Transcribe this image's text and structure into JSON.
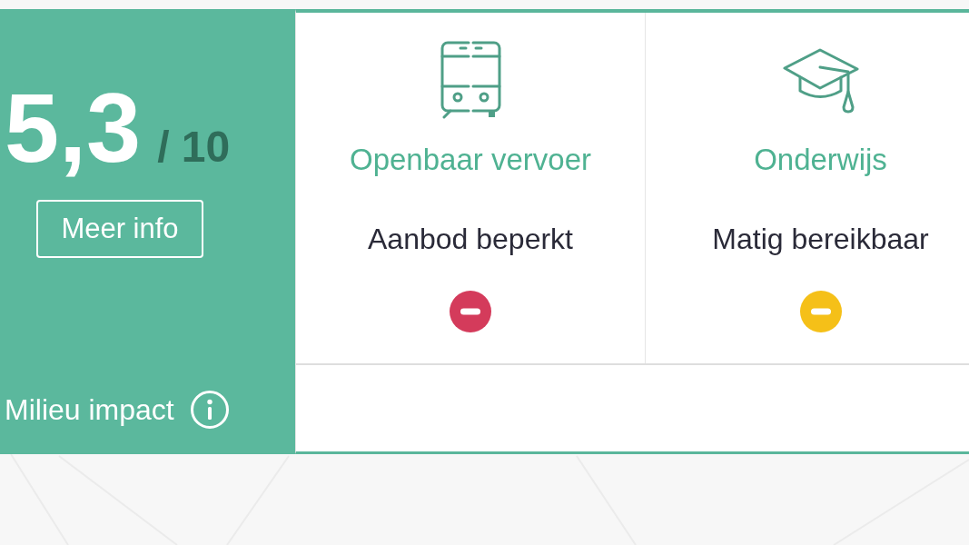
{
  "score_panel": {
    "score": "5,3",
    "scale": "/ 10",
    "button": "Meer info",
    "footer": "Milieu impact"
  },
  "categories": [
    {
      "kind": "transit",
      "title": "Openbaar vervoer",
      "status": "Aanbod beperkt",
      "color": "#d43b5b"
    },
    {
      "kind": "education",
      "title": "Onderwijs",
      "status": "Matig bereikbaar",
      "color": "#f5c018"
    }
  ]
}
